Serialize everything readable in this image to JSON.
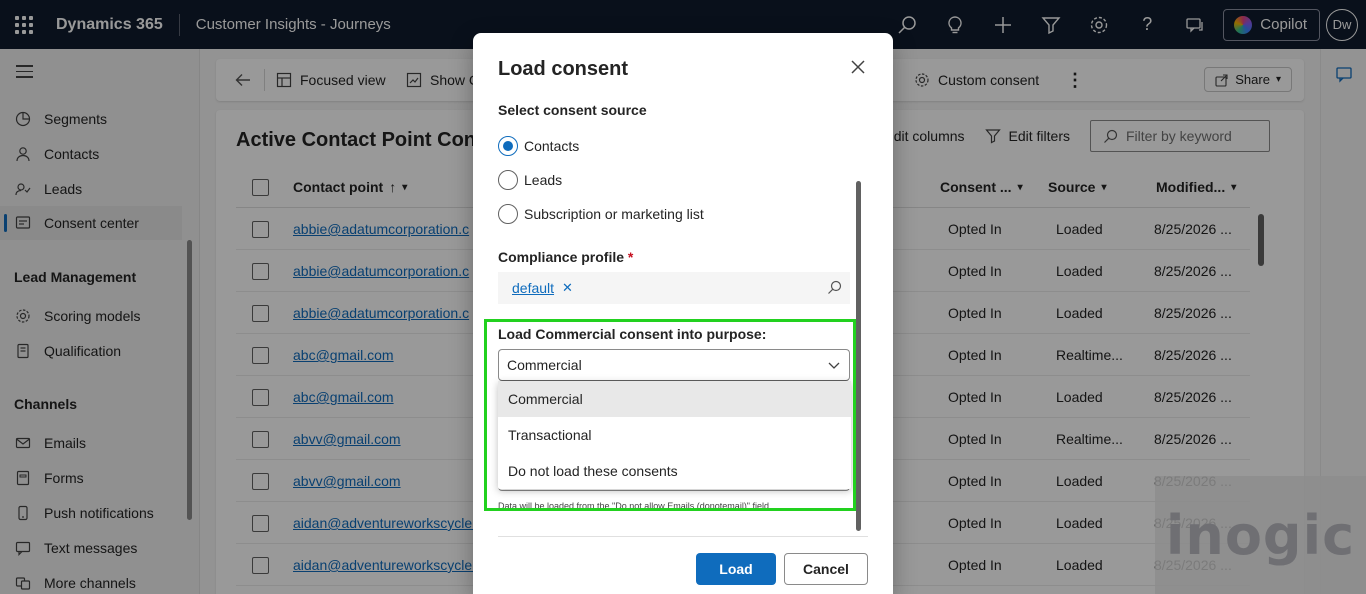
{
  "topbar": {
    "brand": "Dynamics 365",
    "app_name": "Customer Insights - Journeys",
    "copilot_label": "Copilot",
    "avatar_initials": "Dw",
    "icons": [
      "search-icon",
      "lightbulb-icon",
      "plus-icon",
      "filter-icon",
      "gear-icon",
      "help-icon",
      "chat-icon"
    ]
  },
  "sidebar": {
    "items": [
      {
        "label": "Segments",
        "icon": "segments-icon"
      },
      {
        "label": "Contacts",
        "icon": "person-icon"
      },
      {
        "label": "Leads",
        "icon": "leads-icon"
      },
      {
        "label": "Consent center",
        "icon": "consent-icon",
        "active": true
      }
    ],
    "group_lead": "Lead Management",
    "lead_items": [
      {
        "label": "Scoring models",
        "icon": "gear-icon"
      },
      {
        "label": "Qualification",
        "icon": "document-icon"
      }
    ],
    "group_channels": "Channels",
    "channel_items": [
      {
        "label": "Emails",
        "icon": "mail-icon"
      },
      {
        "label": "Forms",
        "icon": "form-icon"
      },
      {
        "label": "Push notifications",
        "icon": "phone-icon"
      },
      {
        "label": "Text messages",
        "icon": "message-icon"
      },
      {
        "label": "More channels",
        "icon": "channels-icon"
      }
    ]
  },
  "commandbar": {
    "focused_view": "Focused view",
    "show_chart": "Show C",
    "custom_consent": "Custom consent",
    "share": "Share"
  },
  "grid": {
    "title": "Active Contact Point Conse",
    "edit_columns": "dit columns",
    "edit_filters": "Edit filters",
    "filter_placeholder": "Filter by keyword",
    "columns": {
      "contact_point": "Contact point",
      "consent": "Consent ...",
      "source": "Source",
      "modified": "Modified..."
    },
    "rows": [
      {
        "contact": "abbie@adatumcorporation.c",
        "consent": "Opted In",
        "source": "Loaded",
        "modified": "8/25/2026 ..."
      },
      {
        "contact": "abbie@adatumcorporation.c",
        "consent": "Opted In",
        "source": "Loaded",
        "modified": "8/25/2026 ..."
      },
      {
        "contact": "abbie@adatumcorporation.c",
        "consent": "Opted In",
        "source": "Loaded",
        "modified": "8/25/2026 ..."
      },
      {
        "contact": "abc@gmail.com",
        "consent": "Opted In",
        "source": "Realtime...",
        "modified": "8/25/2026 ..."
      },
      {
        "contact": "abc@gmail.com",
        "consent": "Opted In",
        "source": "Loaded",
        "modified": "8/25/2026 ..."
      },
      {
        "contact": "abvv@gmail.com",
        "consent": "Opted In",
        "source": "Realtime...",
        "modified": "8/25/2026 ..."
      },
      {
        "contact": "abvv@gmail.com",
        "consent": "Opted In",
        "source": "Loaded",
        "modified": "8/25/2026 ..."
      },
      {
        "contact": "aidan@adventureworkscycle.",
        "consent": "Opted In",
        "source": "Loaded",
        "modified": "8/25/2026 ..."
      },
      {
        "contact": "aidan@adventureworkscycle.",
        "consent": "Opted In",
        "source": "Loaded",
        "modified": "8/25/2026 ..."
      }
    ]
  },
  "dialog": {
    "title": "Load consent",
    "source_label": "Select consent source",
    "sources": [
      {
        "label": "Contacts",
        "selected": true
      },
      {
        "label": "Leads",
        "selected": false
      },
      {
        "label": "Subscription or marketing list",
        "selected": false
      }
    ],
    "compliance_label": "Compliance profile",
    "required_mark": "*",
    "compliance_value": "default",
    "purpose_label": "Load Commercial consent into purpose:",
    "purpose_selected": "Commercial",
    "purpose_options": [
      "Commercial",
      "Transactional",
      "Do not load these consents"
    ],
    "helper_text": "Data will be loaded from the \"Do not allow Emails (donotemail)\" field.",
    "load_button": "Load",
    "cancel_button": "Cancel"
  },
  "watermark": "inogic",
  "colors": {
    "accent": "#0f6cbd",
    "topbar": "#0f1b2d",
    "highlight": "#22d11f"
  }
}
